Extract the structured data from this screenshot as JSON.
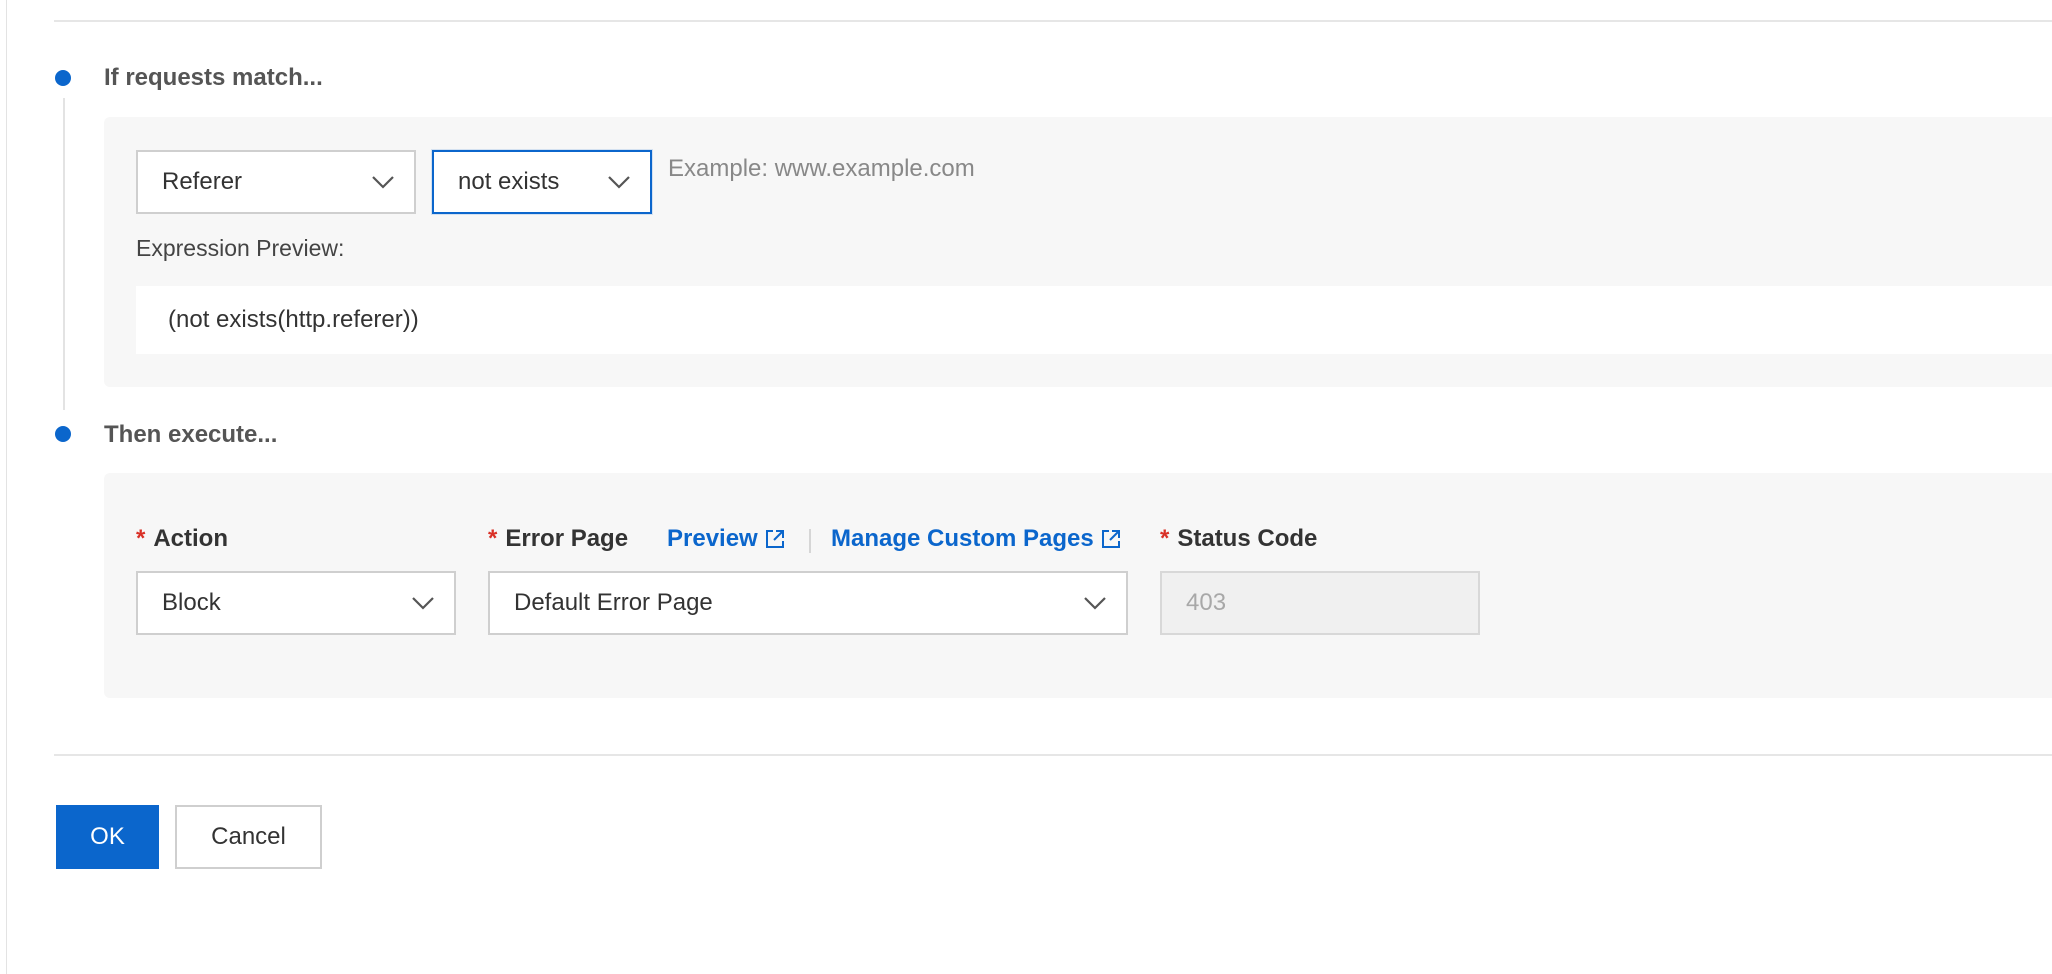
{
  "condition": {
    "title": "If requests match...",
    "field_select": "Referer",
    "operator_select": "not exists",
    "value_hint": "Example: www.example.com",
    "preview_label": "Expression Preview:",
    "preview_expression": "(not exists(http.referer))"
  },
  "execute": {
    "title": "Then execute...",
    "required_mark": "*",
    "action_label": "Action",
    "action_value": "Block",
    "error_page_label": "Error Page",
    "preview_link": "Preview",
    "manage_link": "Manage Custom Pages",
    "error_page_value": "Default Error Page",
    "status_code_label": "Status Code",
    "status_code_value": "403"
  },
  "footer": {
    "ok_label": "OK",
    "cancel_label": "Cancel"
  },
  "colors": {
    "accent": "#0b66cc",
    "required": "#d93026",
    "panel_bg": "#f7f7f7"
  },
  "icons": [
    "chevron-down-icon",
    "external-link-icon"
  ]
}
